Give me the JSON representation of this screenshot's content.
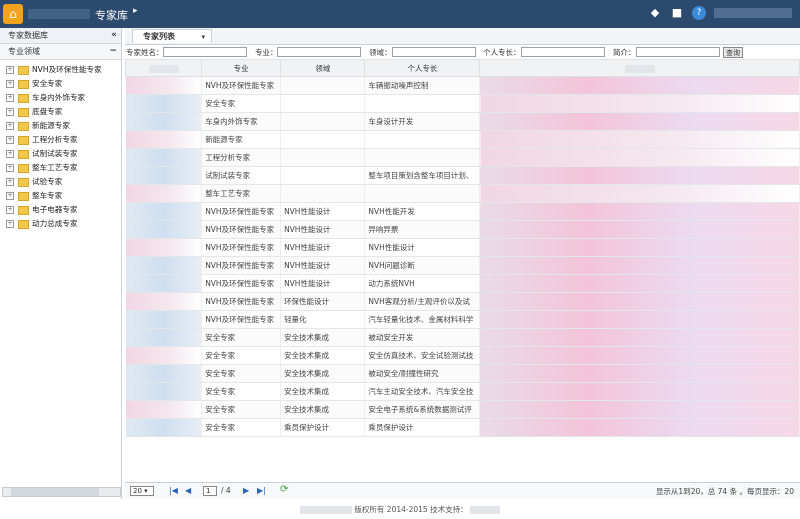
{
  "header": {
    "app_title": "专家库",
    "icons": [
      "tag-icon",
      "chat-icon",
      "help-icon"
    ]
  },
  "sidebar": {
    "title": "专家数据库",
    "collapse_label": "«",
    "subtitle": "专业领域",
    "subtitle_btn": "−",
    "items": [
      {
        "label": "NVH及环保性能专家"
      },
      {
        "label": "安全专家"
      },
      {
        "label": "车身内外饰专家"
      },
      {
        "label": "底盘专家"
      },
      {
        "label": "新能源专家"
      },
      {
        "label": "工程分析专家"
      },
      {
        "label": "试制试装专家"
      },
      {
        "label": "整车工艺专家"
      },
      {
        "label": "试验专家"
      },
      {
        "label": "整车专家"
      },
      {
        "label": "电子电器专家"
      },
      {
        "label": "动力总成专家"
      }
    ]
  },
  "tab": {
    "label": "专家列表",
    "caret": "▾"
  },
  "filters": {
    "name_label": "专家姓名：",
    "major_label": "专业：",
    "field_label": "领域：",
    "skill_label": "个人专长：",
    "intro_label": "简介：",
    "search_label": "查询"
  },
  "table": {
    "headers": [
      "专业",
      "领域",
      "个人专长"
    ],
    "rows": [
      {
        "major": "NVH及环保性能专家",
        "field": "",
        "skill": "车辆振动噪声控制"
      },
      {
        "major": "安全专家",
        "field": "",
        "skill": ""
      },
      {
        "major": "车身内外饰专家",
        "field": "",
        "skill": "车身设计开发"
      },
      {
        "major": "新能源专家",
        "field": "",
        "skill": ""
      },
      {
        "major": "工程分析专家",
        "field": "",
        "skill": ""
      },
      {
        "major": "试制试装专家",
        "field": "",
        "skill": "整车项目策划含整车项目计划、"
      },
      {
        "major": "整车工艺专家",
        "field": "",
        "skill": ""
      },
      {
        "major": "NVH及环保性能专家",
        "field": "NVH性能设计",
        "skill": "NVH性能开发"
      },
      {
        "major": "NVH及环保性能专家",
        "field": "NVH性能设计",
        "skill": "异响异票"
      },
      {
        "major": "NVH及环保性能专家",
        "field": "NVH性能设计",
        "skill": "NVH性能设计"
      },
      {
        "major": "NVH及环保性能专家",
        "field": "NVH性能设计",
        "skill": "NVH问题诊断"
      },
      {
        "major": "NVH及环保性能专家",
        "field": "NVH性能设计",
        "skill": "动力系统NVH"
      },
      {
        "major": "NVH及环保性能专家",
        "field": "环保性能设计",
        "skill": "NVH客观分析/主观评价以及试"
      },
      {
        "major": "NVH及环保性能专家",
        "field": "轻量化",
        "skill": "汽车轻量化技术、金属材料科学"
      },
      {
        "major": "安全专家",
        "field": "安全技术集成",
        "skill": "被动安全开发"
      },
      {
        "major": "安全专家",
        "field": "安全技术集成",
        "skill": "安全仿真技术、安全试验测试技"
      },
      {
        "major": "安全专家",
        "field": "安全技术集成",
        "skill": "被动安全/耐撞性研究"
      },
      {
        "major": "安全专家",
        "field": "安全技术集成",
        "skill": "汽车主动安全技术、汽车安全技"
      },
      {
        "major": "安全专家",
        "field": "安全技术集成",
        "skill": "安全电子系统&系统数据测试评"
      },
      {
        "major": "安全专家",
        "field": "乘员保护设计",
        "skill": "乘员保护设计"
      }
    ]
  },
  "pager": {
    "page_size": "20",
    "current_page": "1",
    "total_pages": "/ 4",
    "info": "显示从1到20，总 74 条 。每页显示：20"
  },
  "footer": {
    "text": "版权所有 2014-2015 技术支持："
  }
}
